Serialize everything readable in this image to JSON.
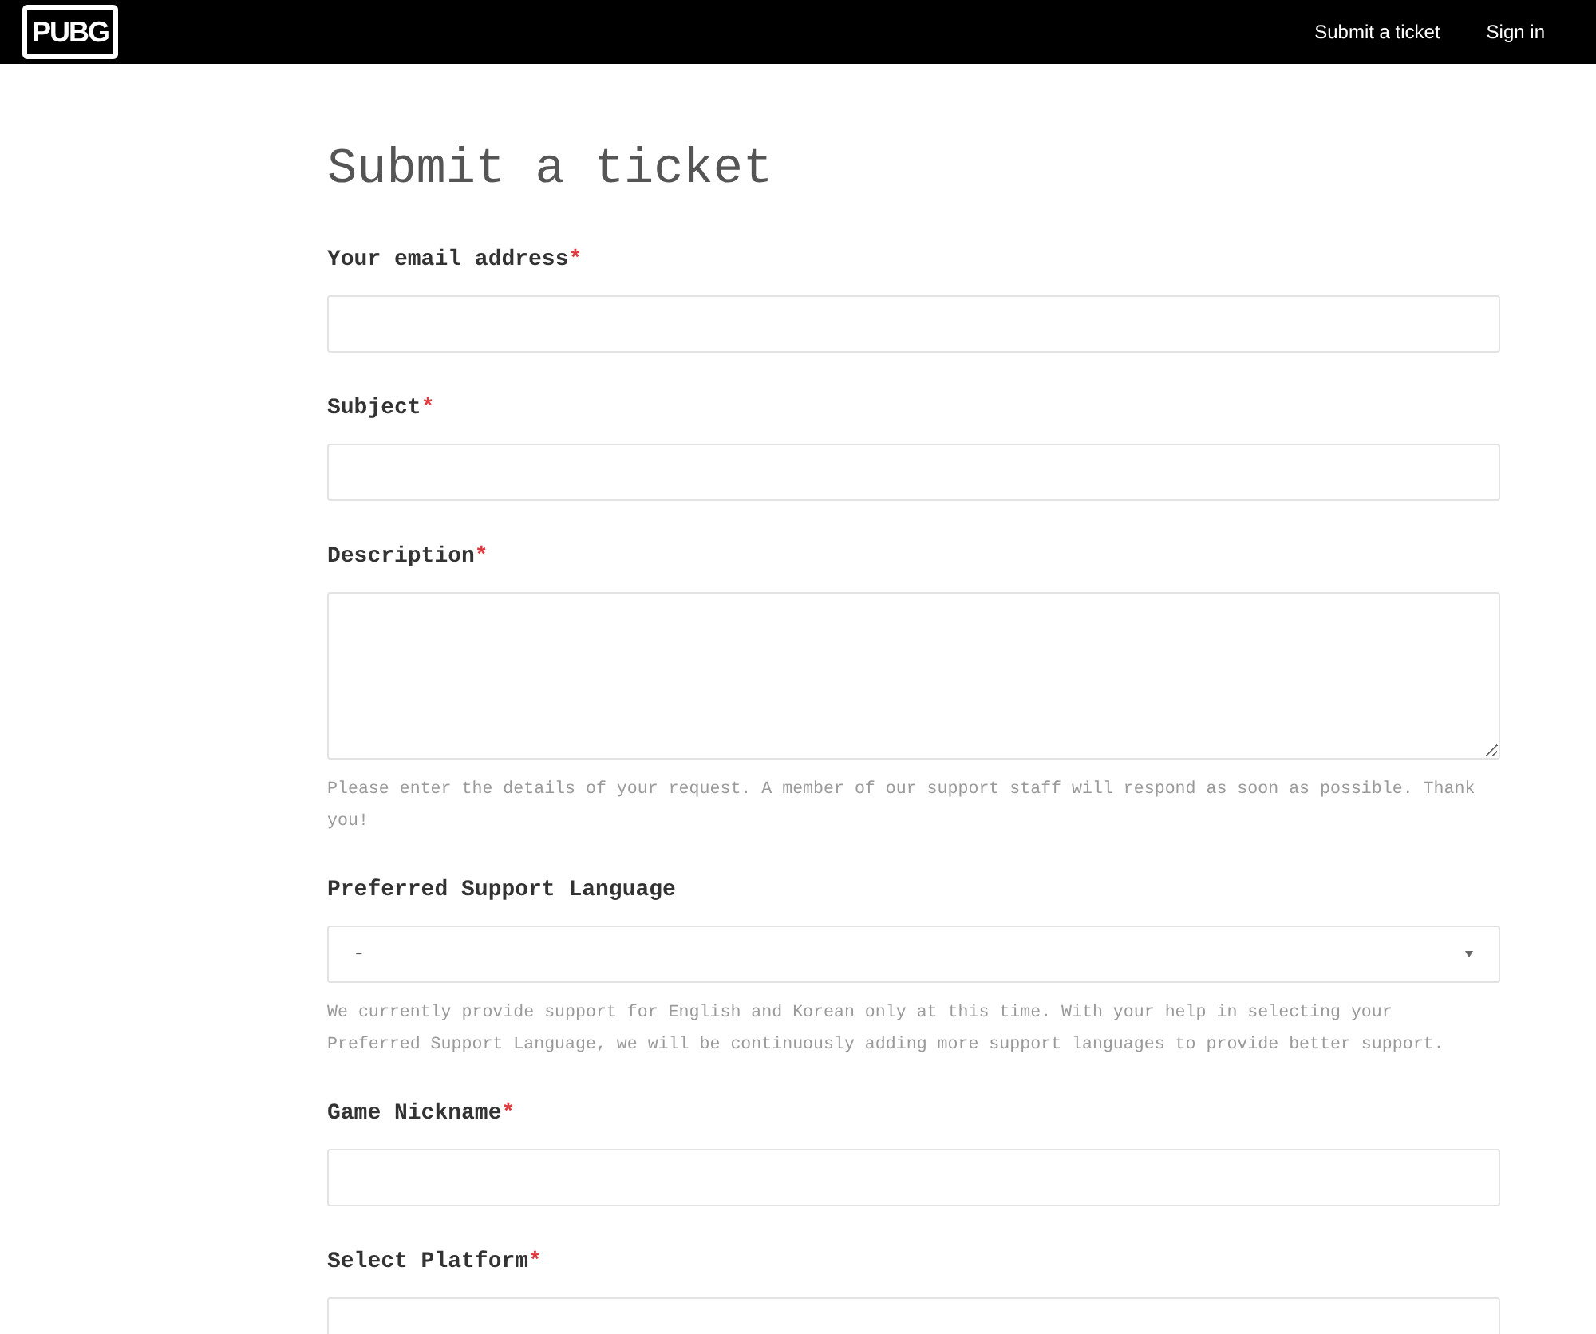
{
  "header": {
    "logo": "PUBG",
    "nav": [
      {
        "label": "Submit a ticket"
      },
      {
        "label": "Sign in"
      }
    ]
  },
  "form": {
    "title": "Submit a ticket",
    "fields": [
      {
        "kind": "input",
        "label": "Your email address",
        "required_mark": "*"
      },
      {
        "kind": "input",
        "label": "Subject",
        "required_mark": "*"
      },
      {
        "kind": "textarea",
        "label": "Description",
        "required_mark": "*",
        "hint": "Please enter the details of your request. A member of our support staff will respond as soon as possible. Thank you!"
      },
      {
        "kind": "select",
        "label": "Preferred Support Language",
        "value": "-",
        "hint": "We currently provide support for English and Korean only at this time. With your help in selecting your Preferred Support Language, we will be continuously adding more support languages to provide better support."
      },
      {
        "kind": "input",
        "label": "Game Nickname",
        "required_mark": "*"
      },
      {
        "kind": "input",
        "label": "Select Platform",
        "required_mark": "*"
      }
    ]
  }
}
